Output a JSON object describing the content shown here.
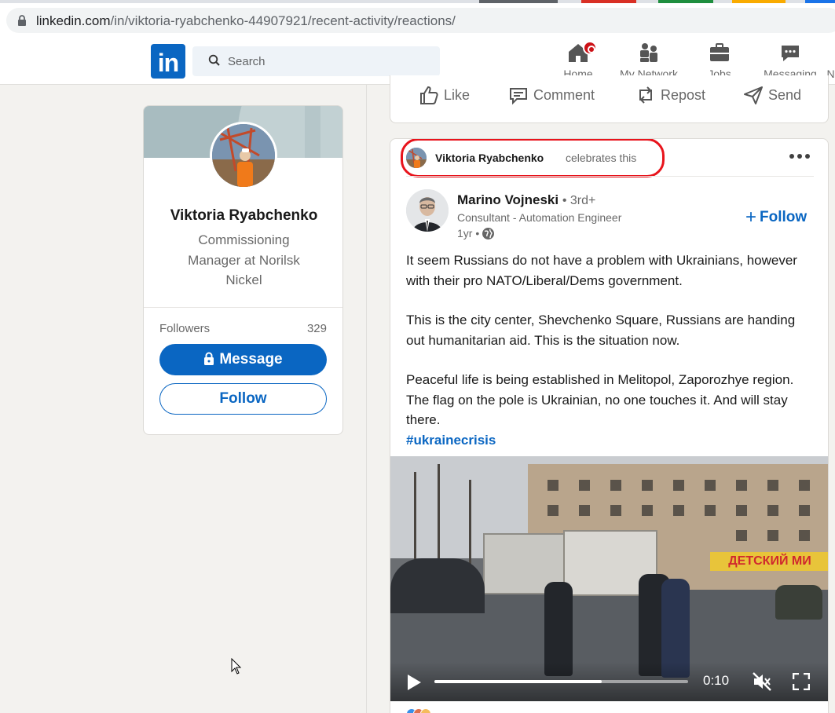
{
  "browser": {
    "url_host": "linkedin.com",
    "url_path": "/in/viktoria-ryabchenko-44907921/recent-activity/reactions/"
  },
  "nav": {
    "logo": "in",
    "search_placeholder": "Search",
    "items": [
      {
        "label": "Home",
        "icon": "home-icon"
      },
      {
        "label": "My Network",
        "icon": "network-icon"
      },
      {
        "label": "Jobs",
        "icon": "briefcase-icon"
      },
      {
        "label": "Messaging",
        "icon": "messaging-icon"
      },
      {
        "label": "N",
        "icon": "notifications-icon"
      }
    ],
    "brand_color": "#0a66c2",
    "badge_color": "#cc1016"
  },
  "profile": {
    "name": "Viktoria Ryabchenko",
    "headline": "Commissioning Manager at Norilsk Nickel",
    "followers_label": "Followers",
    "followers_count": "329",
    "message_label": "Message",
    "follow_label": "Follow"
  },
  "prev_actions": [
    {
      "label": "Like",
      "icon": "like-icon"
    },
    {
      "label": "Comment",
      "icon": "comment-icon"
    },
    {
      "label": "Repost",
      "icon": "repost-icon"
    },
    {
      "label": "Send",
      "icon": "send-icon"
    }
  ],
  "post": {
    "activity_actor": "Viktoria Ryabchenko",
    "activity_text": "celebrates this",
    "highlight_color": "#e8141c",
    "author_name": "Marino Vojneski",
    "author_degree": "• 3rd+",
    "author_title": "Consultant - Automation Engineer",
    "author_time": "1yr •",
    "follow_label": "Follow",
    "paragraph_1": "It seem Russians do not have a problem with Ukrainians, however with their pro NATO/Liberal/Dems government.",
    "paragraph_2": "This is the city center, Shevchenko Square, Russians are handing out humanitarian aid. This is the situation now.",
    "paragraph_3": "Peaceful life is being established in Melitopol, Zaporozhye region. The flag on the pole is Ukrainian, no one touches it. And will stay there.",
    "hashtag": "#ukrainecrisis",
    "video": {
      "time": "0:10",
      "progress": 0.66,
      "sign_text": "ДЕТСКИЙ МИ"
    }
  }
}
